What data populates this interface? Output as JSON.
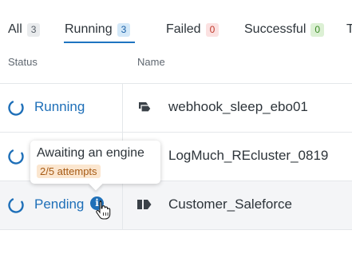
{
  "tabs": [
    {
      "label": "All",
      "count": "3"
    },
    {
      "label": "Running",
      "count": "3"
    },
    {
      "label": "Failed",
      "count": "0"
    },
    {
      "label": "Successful",
      "count": "0"
    },
    {
      "label": "T"
    }
  ],
  "active_tab": "Running",
  "table": {
    "headers": {
      "status": "Status",
      "name": "Name"
    },
    "rows": [
      {
        "status": "Running",
        "name": "webhook_sleep_ebo01",
        "icon": "stacked-pages-icon"
      },
      {
        "status": "",
        "name": "LogMuch_REcluster_0819",
        "icon": "none"
      },
      {
        "status": "Pending",
        "name": "Customer_Saleforce",
        "icon": "tag-icon"
      }
    ]
  },
  "tooltip": {
    "title": "Awaiting an engine",
    "badge": "2/5 attempts"
  },
  "colors": {
    "accent": "#1e74c1",
    "status_text": "#1e6fb8",
    "badge_running": "#d3e8f8",
    "badge_failed": "#fbe1e1",
    "badge_success": "#dcf0d4",
    "badge_attempts": "#fbe6cf"
  }
}
